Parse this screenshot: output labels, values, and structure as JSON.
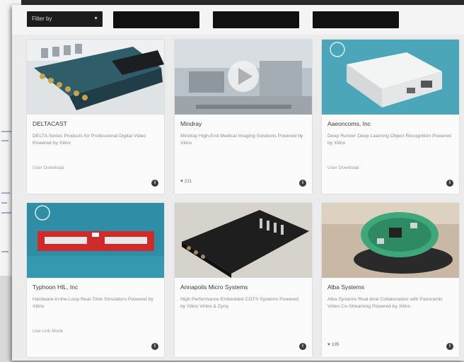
{
  "filter": {
    "label": "Filter by",
    "chevron": "chevron-down-icon"
  },
  "cards": [
    {
      "name": "DELTACAST",
      "description": "DELTA-Series Products for Professional Digital Video Powered by Xilinx",
      "action": "User Download",
      "likes": "",
      "info": "i"
    },
    {
      "name": "Mindray",
      "description": "Mindray High-End Medical Imaging Solutions Powered by Xilinx",
      "action": "",
      "likes": "♥ 211",
      "info": "i"
    },
    {
      "name": "Aaeoncoms, Inc",
      "description": "Deep Runner Deep Learning Object Recognition Powered by Xilinx",
      "action": "User Download",
      "likes": "",
      "info": "i"
    },
    {
      "name": "Typhoon HIL, Inc",
      "description": "Hardware-in-the-Loop Real-Time Simulators Powered by Xilinx",
      "action": "Use Link Mode",
      "likes": "",
      "info": "i"
    },
    {
      "name": "Annapolis Micro Systems",
      "description": "High Performance Embedded COTS Systems Powered by Xilinx Virtex & Zynq",
      "action": "",
      "likes": "",
      "info": "i"
    },
    {
      "name": "Alba Systems",
      "description": "Alba Systems Real-time Collaboration with Panoramic Video Co-Streaming Powered by Xilinx",
      "action": "",
      "likes": "♥ 195",
      "info": "i"
    }
  ]
}
